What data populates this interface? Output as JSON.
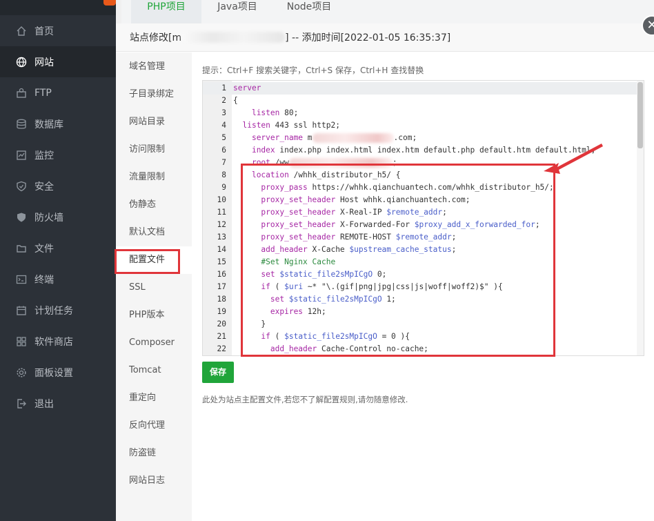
{
  "sidebar": {
    "items": [
      {
        "label": "首页",
        "icon": "home-icon"
      },
      {
        "label": "网站",
        "icon": "globe-icon",
        "active": true
      },
      {
        "label": "FTP",
        "icon": "ftp-icon"
      },
      {
        "label": "数据库",
        "icon": "database-icon"
      },
      {
        "label": "监控",
        "icon": "monitor-icon"
      },
      {
        "label": "安全",
        "icon": "shield-icon"
      },
      {
        "label": "防火墙",
        "icon": "firewall-icon"
      },
      {
        "label": "文件",
        "icon": "folder-icon"
      },
      {
        "label": "终端",
        "icon": "terminal-icon"
      },
      {
        "label": "计划任务",
        "icon": "calendar-icon"
      },
      {
        "label": "软件商店",
        "icon": "apps-icon"
      },
      {
        "label": "面板设置",
        "icon": "gear-icon"
      },
      {
        "label": "退出",
        "icon": "logout-icon"
      }
    ]
  },
  "tabs": [
    {
      "label": "PHP项目",
      "active": true
    },
    {
      "label": "Java项目"
    },
    {
      "label": "Node项目"
    }
  ],
  "dialog": {
    "title_prefix": "站点修改[m",
    "title_suffix": "] -- 添加时间[2022-01-05 16:35:37]",
    "close_icon": "close-icon",
    "menu": [
      "域名管理",
      "子目录绑定",
      "网站目录",
      "访问限制",
      "流量限制",
      "伪静态",
      "默认文档",
      "配置文件",
      "SSL",
      "PHP版本",
      "Composer",
      "Tomcat",
      "重定向",
      "反向代理",
      "防盗链",
      "网站日志"
    ],
    "active_menu": "配置文件",
    "hint": "提示：Ctrl+F 搜索关键字，Ctrl+S 保存，Ctrl+H 查找替换",
    "save_label": "保存",
    "note": "此处为站点主配置文件,若您不了解配置规则,请勿随意修改."
  },
  "editor": {
    "lines": [
      "server",
      "{",
      "    listen 80;",
      "  listen 443 ssl http2;",
      "    server_name m                .com;",
      "    index index.php index.html index.htm default.php default.htm default.html;",
      "    root /ww                       ;",
      "    location /whhk_distributor_h5/ {",
      "      proxy_pass https://whhk.qianchuantech.com/whhk_distributor_h5/;",
      "      proxy_set_header Host whhk.qianchuantech.com;",
      "      proxy_set_header X-Real-IP $remote_addr;",
      "      proxy_set_header X-Forwarded-For $proxy_add_x_forwarded_for;",
      "      proxy_set_header REMOTE-HOST $remote_addr;",
      "      add_header X-Cache $upstream_cache_status;",
      "      #Set Nginx Cache",
      "      set $static_file2sMpICgO 0;",
      "      if ( $uri ~* \"\\.(gif|png|jpg|css|js|woff|woff2)$\" ){",
      "        set $static_file2sMpICgO 1;",
      "        expires 12h;",
      "      }",
      "      if ( $static_file2sMpICgO = 0 ){",
      "        add_header Cache-Control no-cache;"
    ],
    "line_numbers": [
      "1",
      "2",
      "3",
      "4",
      "5",
      "6",
      "7",
      "8",
      "9",
      "10",
      "11",
      "12",
      "13",
      "14",
      "15",
      "16",
      "17",
      "18",
      "19",
      "20",
      "21",
      "22"
    ]
  },
  "colors": {
    "accent": "#20a53a",
    "highlight_border": "#e0353a",
    "sidebar_bg": "#2c3138"
  }
}
